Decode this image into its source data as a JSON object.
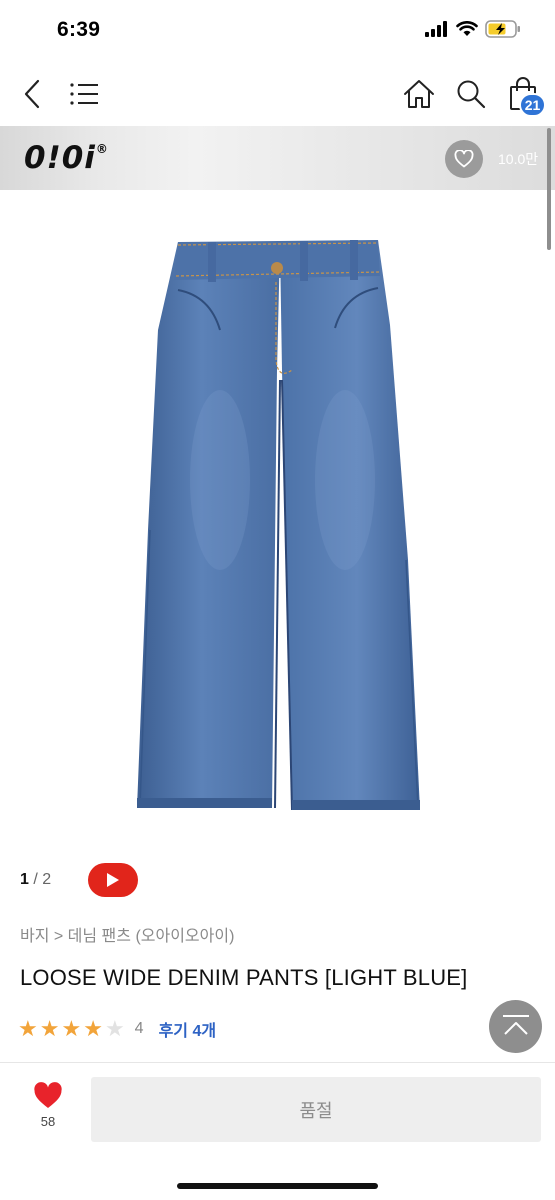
{
  "status_bar": {
    "time": "6:39"
  },
  "nav": {
    "cart_count": "21"
  },
  "brand": {
    "logo": "0!0i",
    "logo_mark": "®",
    "like_count": "10.0만"
  },
  "gallery": {
    "current": "1",
    "separator": " / ",
    "total": "2"
  },
  "product": {
    "breadcrumb": "바지 > 데님 팬츠 (오아이오아이)",
    "title": "LOOSE WIDE DENIM PANTS [LIGHT BLUE]",
    "rating": {
      "stars_filled": 4,
      "stars_total": 5,
      "value": "4",
      "review_link": "후기 4개"
    }
  },
  "actions": {
    "like_count": "58",
    "buy_label": "품절"
  },
  "colors": {
    "accent_blue": "#2f74d6",
    "review_blue": "#2d62c4",
    "star_orange": "#f2a43a",
    "video_red": "#e1251b",
    "heart_red": "#e8232b"
  },
  "icons": [
    "back-icon",
    "menu-icon",
    "home-icon",
    "search-icon",
    "shopping-bag-icon",
    "heart-icon",
    "play-icon",
    "scroll-top-icon"
  ]
}
